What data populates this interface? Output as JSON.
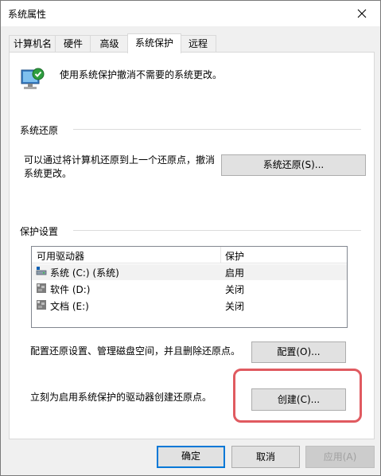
{
  "window": {
    "title": "系统属性"
  },
  "tabs": [
    {
      "label": "计算机名"
    },
    {
      "label": "硬件"
    },
    {
      "label": "高级"
    },
    {
      "label": "系统保护"
    },
    {
      "label": "远程"
    }
  ],
  "intro": {
    "text": "使用系统保护撤消不需要的系统更改。"
  },
  "restore": {
    "heading": "系统还原",
    "description_line1": "可以通过将计算机还原到上一个还原点，撤消",
    "description_line2": "系统更改。",
    "button_label": "系统还原(S)..."
  },
  "protection": {
    "heading": "保护设置",
    "columns": [
      "可用驱动器",
      "保护"
    ],
    "drives": [
      {
        "name": "系统 (C:) (系统)",
        "status": "启用"
      },
      {
        "name": "软件 (D:)",
        "status": "关闭"
      },
      {
        "name": "文档 (E:)",
        "status": "关闭"
      }
    ],
    "configure_text": "配置还原设置、管理磁盘空间，并且删除还原点。",
    "configure_button": "配置(O)...",
    "create_text": "立刻为启用系统保护的驱动器创建还原点。",
    "create_button": "创建(C)..."
  },
  "footer": {
    "ok": "确定",
    "cancel": "取消",
    "apply": "应用(A)"
  },
  "colors": {
    "accent": "#0078d7",
    "highlight": "#e05a60"
  }
}
